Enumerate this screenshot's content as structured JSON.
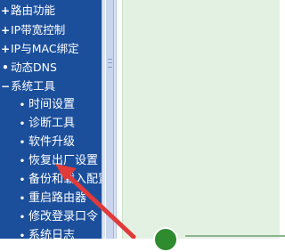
{
  "nav": {
    "items": [
      {
        "icon": "plus-icon",
        "mark": "+",
        "label": "路由功能",
        "level": "top"
      },
      {
        "icon": "plus-icon",
        "mark": "+",
        "label": "IP带宽控制",
        "level": "top"
      },
      {
        "icon": "plus-icon",
        "mark": "+",
        "label": "IP与MAC绑定",
        "level": "top"
      },
      {
        "icon": "bullet-icon",
        "mark": "•",
        "label": "动态DNS",
        "level": "top"
      },
      {
        "icon": "minus-icon",
        "mark": "−",
        "label": "系统工具",
        "level": "top"
      },
      {
        "icon": "bullet-icon",
        "mark": "•",
        "label": "时间设置",
        "level": "sub"
      },
      {
        "icon": "bullet-icon",
        "mark": "•",
        "label": "诊断工具",
        "level": "sub"
      },
      {
        "icon": "bullet-icon",
        "mark": "•",
        "label": "软件升级",
        "level": "sub"
      },
      {
        "icon": "bullet-icon",
        "mark": "•",
        "label": "恢复出厂设置",
        "level": "sub"
      },
      {
        "icon": "bullet-icon",
        "mark": "•",
        "label": "备份和载入配置",
        "level": "sub"
      },
      {
        "icon": "bullet-icon",
        "mark": "•",
        "label": "重启路由器",
        "level": "sub"
      },
      {
        "icon": "bullet-icon",
        "mark": "•",
        "label": "修改登录口令",
        "level": "sub"
      },
      {
        "icon": "bullet-icon",
        "mark": "•",
        "label": "系统日志",
        "level": "sub"
      }
    ]
  },
  "colors": {
    "nav_bg": "#1b4f9c",
    "nav_text": "#ffffff",
    "arrow": "#e03a3a",
    "panel": "#e3f1e3"
  },
  "annotation": {
    "icon": "red-arrow-icon",
    "points_to": "恢复出厂设置"
  }
}
